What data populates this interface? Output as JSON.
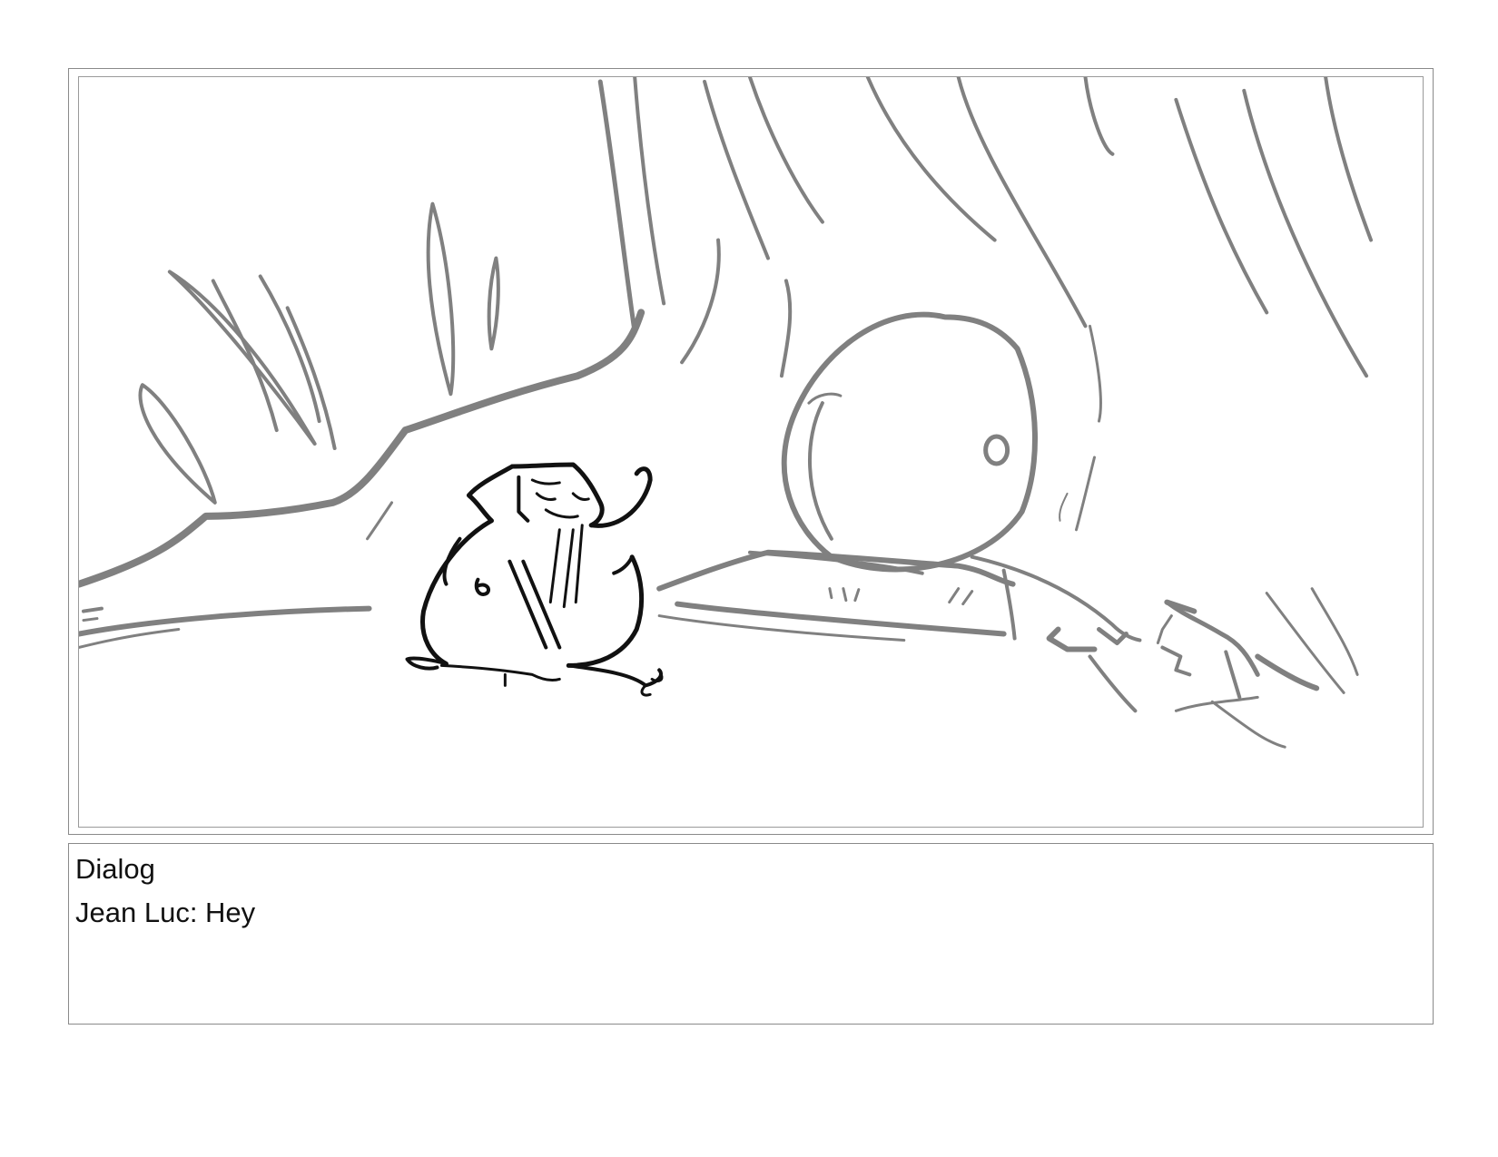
{
  "panel": {
    "image_icon": "storyboard-sketch"
  },
  "caption": {
    "heading": "Dialog",
    "line": "Jean Luc: Hey"
  }
}
